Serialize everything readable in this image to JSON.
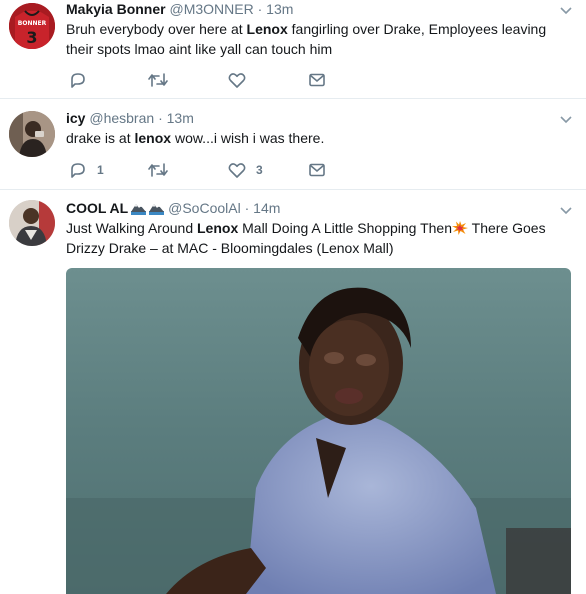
{
  "tweets": [
    {
      "name": "Makyia Bonner",
      "handle": "@M3ONNER",
      "sep": "·",
      "time": "13m",
      "avatar_jersey_text": "BONNER",
      "text_parts": [
        "Bruh everybody over here at ",
        "Lenox",
        " fangirling over Drake, Employees leaving their spots lmao aint like yall can touch him"
      ],
      "reply_count": "",
      "retweet_count": "",
      "like_count": ""
    },
    {
      "name": "icy",
      "handle": "@hesbran",
      "sep": "·",
      "time": "13m",
      "text_parts": [
        "drake is at ",
        "lenox",
        " wow...i wish i was there."
      ],
      "reply_count": "1",
      "retweet_count": "",
      "like_count": "3"
    },
    {
      "name": "COOL AL",
      "handle": "@SoCoolAl",
      "sep": "·",
      "time": "14m",
      "text_parts": [
        "Just Walking Around ",
        "Lenox",
        " Mall Doing A Little Shopping Then",
        " There Goes Drizzy Drake ",
        " – at MAC - Bloomingdales (Lenox Mall)"
      ],
      "name_emojis": [
        "mountain-icon",
        "mountain-icon"
      ],
      "inline_emoji": "collision-icon",
      "media": "video-still"
    }
  ],
  "colors": {
    "text": "#14171a",
    "secondary": "#657786",
    "divider": "#e6ecf0",
    "caret": "#8899a6"
  },
  "icons": [
    "reply-icon",
    "retweet-icon",
    "like-icon",
    "direct-message-icon",
    "caret-down-icon"
  ]
}
